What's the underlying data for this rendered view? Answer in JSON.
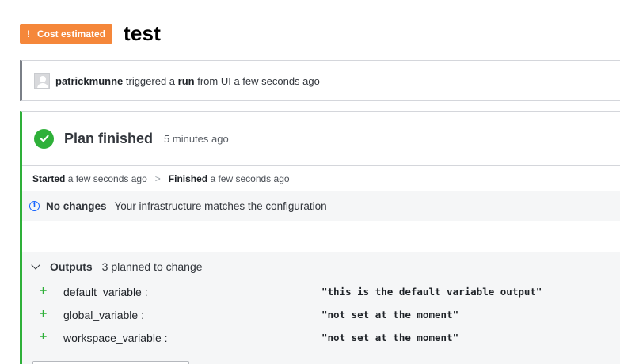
{
  "header": {
    "badge_icon": "!",
    "badge_label": "Cost estimated",
    "badge_color": "#f5873a",
    "title": "test"
  },
  "trigger": {
    "avatar_icon": "avatar-placeholder-icon",
    "user": "patrickmunne",
    "text_before": "triggered a",
    "run_link": "run",
    "text_after": "from UI a few seconds ago"
  },
  "plan": {
    "status_icon": "check-circle-icon",
    "status_color": "#2eb039",
    "title": "Plan finished",
    "time": "5 minutes ago",
    "timeline": {
      "started_label": "Started",
      "started_time": "a few seconds ago",
      "separator": ">",
      "finished_label": "Finished",
      "finished_time": "a few seconds ago"
    },
    "changes": {
      "icon": "info-icon",
      "label": "No changes",
      "message": "Your infrastructure matches the configuration"
    },
    "outputs": {
      "label": "Outputs",
      "summary": "3 planned to change",
      "rows": [
        {
          "sign": "+",
          "name": "default_variable :",
          "value": "\"this is the default variable output\""
        },
        {
          "sign": "+",
          "name": "global_variable :",
          "value": "\"not set at the moment\""
        },
        {
          "sign": "+",
          "name": "workspace_variable :",
          "value": "\"not set at the moment\""
        }
      ]
    }
  }
}
